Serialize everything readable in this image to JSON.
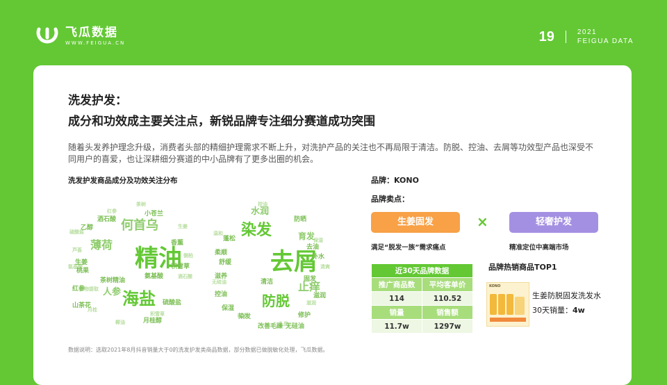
{
  "header": {
    "logo_name": "飞瓜数据",
    "logo_url": "WWW.FEIGUA.CN",
    "page_number": "19",
    "year": "2021",
    "company": "FEIGUA DATA"
  },
  "title": "洗发护发：",
  "subtitle": "成分和功效成主要关注点，新锐品牌专注细分赛道成功突围",
  "paragraph": "随着头发养护理念升级，消费者头部的精细护理需求不断上升，对洗护产品的关注也不再局限于清洁。防脱、控油、去屑等功效型产品也深受不同用户的喜爱，也让深耕细分赛道的中小品牌有了更多出圈的机会。",
  "wordcloud": {
    "title": "洗发护发商品成分及功效关注分布",
    "ingredients": {
      "big": [
        "精油",
        "海盐",
        "何首乌",
        "薄荷",
        "人参"
      ],
      "medium": [
        "乙醇",
        "生姜",
        "氨基酸",
        "香薰",
        "山茶花",
        "月桂醇",
        "桃果",
        "茶树精油",
        "积雪草",
        "小苍兰",
        "硫酸盐",
        "红参",
        "酒石酸"
      ]
    },
    "effects": {
      "big": [
        "去屑",
        "染发",
        "防脱",
        "止痒",
        "水润",
        "育发"
      ],
      "medium": [
        "舒缓",
        "滋养",
        "控油",
        "柔顺",
        "清洁",
        "修护",
        "防晒",
        "补水",
        "蓬松",
        "固发",
        "改善毛躁",
        "染发",
        "去油",
        "保湿",
        "滋润",
        "无硅油"
      ]
    }
  },
  "brand": {
    "label": "品牌：KONO",
    "selling_points_label": "品牌卖点：",
    "point1": "生姜固发",
    "point2": "轻奢护发",
    "cross": "×",
    "need1": "满足“脱发一族”需求痛点",
    "need2": "精准定位中高端市场",
    "colors": {
      "orange": "#f8a147",
      "purple": "#a490e2",
      "green": "#63c834"
    }
  },
  "table": {
    "title": "近30天品牌数据",
    "h1": "推广商品数",
    "h2": "平均客单价",
    "v1": "114",
    "v2": "110.52",
    "h3": "销量",
    "h4": "销售额",
    "v3": "11.7w",
    "v4": "1297w"
  },
  "top_product": {
    "title": "品牌热销商品TOP1",
    "name": "生姜防脱固发洗发水",
    "sales_label": "30天销量：",
    "sales_value": "4w",
    "image_brand": "KONO"
  },
  "footnote": "数据说明：选取2021年8月抖音销量大于0的洗发护发类商品数据，部分数据已做脱敏化处理，飞瓜数据。"
}
